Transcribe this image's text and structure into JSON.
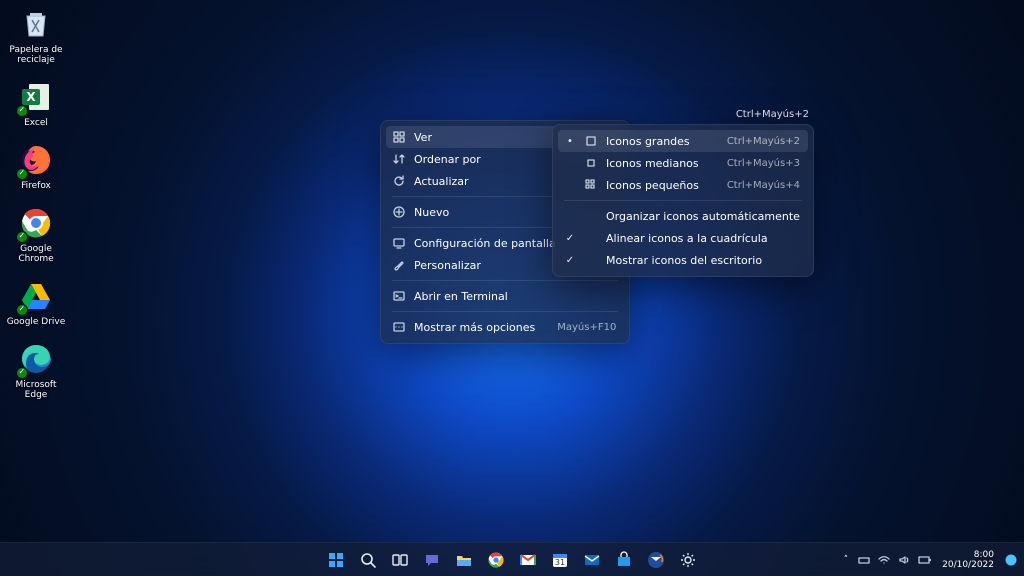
{
  "desktop_icons": [
    {
      "id": "recycle-bin",
      "label": "Papelera de\nreciclaje"
    },
    {
      "id": "excel",
      "label": "Excel"
    },
    {
      "id": "firefox",
      "label": "Firefox"
    },
    {
      "id": "chrome",
      "label": "Google Chrome"
    },
    {
      "id": "gdrive",
      "label": "Google Drive"
    },
    {
      "id": "edge",
      "label": "Microsoft Edge"
    }
  ],
  "context_menu": {
    "items": [
      {
        "icon": "grid",
        "label": "Ver",
        "submenu": true,
        "active": true
      },
      {
        "icon": "sort",
        "label": "Ordenar por",
        "submenu": true
      },
      {
        "icon": "refresh",
        "label": "Actualizar"
      },
      {
        "sep": true
      },
      {
        "icon": "plus",
        "label": "Nuevo",
        "submenu": true
      },
      {
        "sep": true
      },
      {
        "icon": "display",
        "label": "Configuración de pantalla"
      },
      {
        "icon": "brush",
        "label": "Personalizar"
      },
      {
        "sep": true
      },
      {
        "icon": "terminal",
        "label": "Abrir en Terminal"
      },
      {
        "sep": true
      },
      {
        "icon": "more",
        "label": "Mostrar más opciones",
        "shortcut": "Mayús+F10"
      }
    ]
  },
  "submenu": {
    "hint_shortcut": "Ctrl+Mayús+2",
    "items": [
      {
        "check": "•",
        "icon": "large",
        "label": "Iconos grandes",
        "shortcut": "Ctrl+Mayús+2",
        "active": true
      },
      {
        "check": "",
        "icon": "medium",
        "label": "Iconos medianos",
        "shortcut": "Ctrl+Mayús+3"
      },
      {
        "check": "",
        "icon": "small",
        "label": "Iconos pequeños",
        "shortcut": "Ctrl+Mayús+4"
      },
      {
        "sep": true
      },
      {
        "check": "",
        "icon": "",
        "label": "Organizar iconos automáticamente"
      },
      {
        "check": "✓",
        "icon": "",
        "label": "Alinear iconos a la cuadrícula"
      },
      {
        "check": "✓",
        "icon": "",
        "label": "Mostrar iconos del escritorio"
      }
    ]
  },
  "taskbar_apps": [
    "start",
    "search",
    "taskview",
    "chat",
    "explorer",
    "chrome",
    "gmail",
    "calendar",
    "mail",
    "store",
    "thunderbird",
    "settings"
  ],
  "tray": {
    "chevron": "˄",
    "icons": [
      "hw",
      "wifi",
      "sound",
      "battery"
    ]
  },
  "clock": {
    "time": "8:00",
    "date": "20/10/2022"
  }
}
